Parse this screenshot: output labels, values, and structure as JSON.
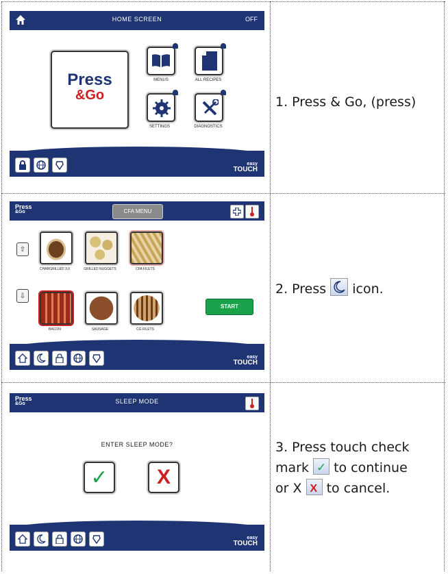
{
  "colors": {
    "navy": "#1f3472",
    "green": "#1aa34a",
    "red": "#cc1f1f",
    "cfa_gray": "#8a8a8a"
  },
  "screen1": {
    "title": "HOME SCREEN",
    "status": "OFF",
    "press_go_line1": "Press",
    "press_go_line2": "&Go",
    "tiles": [
      {
        "label": "MENUS",
        "icon": "book-icon"
      },
      {
        "label": "ALL RECIPES",
        "icon": "document-icon"
      },
      {
        "label": "SETTINGS",
        "icon": "gear-icon"
      },
      {
        "label": "DIAGNOSTICS",
        "icon": "tools-icon"
      }
    ],
    "bottom_icons": [
      "lock-icon",
      "globe-icon",
      "help-icon"
    ],
    "easy": "easy",
    "touch": "TOUCH"
  },
  "screen2": {
    "brand_line1": "Press",
    "brand_line2": "&Go",
    "title": "CFA MENU",
    "items": [
      {
        "label": "CHARGRILLED 3.0"
      },
      {
        "label": "GRILLED NUGGETS"
      },
      {
        "label": "CFA FILETS"
      },
      {
        "label": "BACON"
      },
      {
        "label": "SAUSAGE"
      },
      {
        "label": "CG FILETS"
      }
    ],
    "start": "START",
    "bottom_icons": [
      "home-icon",
      "moon-icon",
      "lock-icon",
      "globe-icon",
      "help-icon"
    ],
    "easy": "easy",
    "touch": "TOUCH"
  },
  "screen3": {
    "brand_line1": "Press",
    "brand_line2": "&Go",
    "title": "SLEEP MODE",
    "prompt": "ENTER SLEEP MODE?",
    "check": "✓",
    "x": "X",
    "bottom_icons": [
      "home-icon",
      "moon-icon",
      "lock-icon",
      "globe-icon",
      "help-icon"
    ],
    "easy": "easy",
    "touch": "TOUCH"
  },
  "steps": {
    "s1": "1.  Press & Go, (press)",
    "s2_a": "2.  Press",
    "s2_b": "icon.",
    "s3_l1": "3.  Press touch check",
    "s3_l2a": "mark",
    "s3_l2b": "to continue",
    "s3_l3a": "or X",
    "s3_l3b": "to cancel."
  }
}
